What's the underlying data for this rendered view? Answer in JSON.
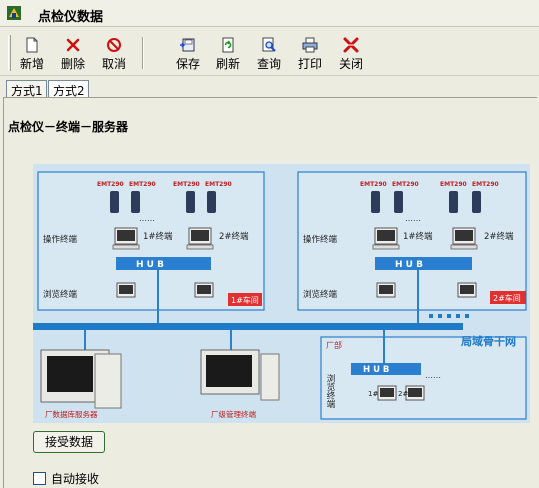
{
  "window": {
    "title": "点检仪数据"
  },
  "toolbar": {
    "new_label": "新增",
    "delete_label": "删除",
    "cancel_label": "取消",
    "save_label": "保存",
    "refresh_label": "刷新",
    "query_label": "查询",
    "print_label": "打印",
    "close_label": "关闭"
  },
  "tabs": [
    {
      "label": "方式1"
    },
    {
      "label": "方式2"
    }
  ],
  "heading": "点检仪－终端－服务器",
  "diagram": {
    "device_label": "EMT290",
    "operator_terminal": "操作终端",
    "browse_terminal": "浏览终端",
    "terminal_1": "1#终端",
    "terminal_2": "2#终端",
    "hub": "H U B",
    "workshop_1": "1#车间",
    "workshop_2": "2#车间",
    "backbone": "局域骨干网",
    "factory": "厂部",
    "browse_vertical": "浏览终端",
    "pc_1": "1#",
    "pc_2": "2#",
    "db_server": "厂数据库服务器",
    "mgmt_terminal": "厂级管理终端",
    "dots": "……"
  },
  "receive_button": "接受数据",
  "auto_receive": {
    "label": "自动接收",
    "checked": false
  },
  "colors": {
    "hub_blue": "#2a7fd0",
    "red_label": "#e03030",
    "backbone_blue": "#1f7ac8"
  }
}
